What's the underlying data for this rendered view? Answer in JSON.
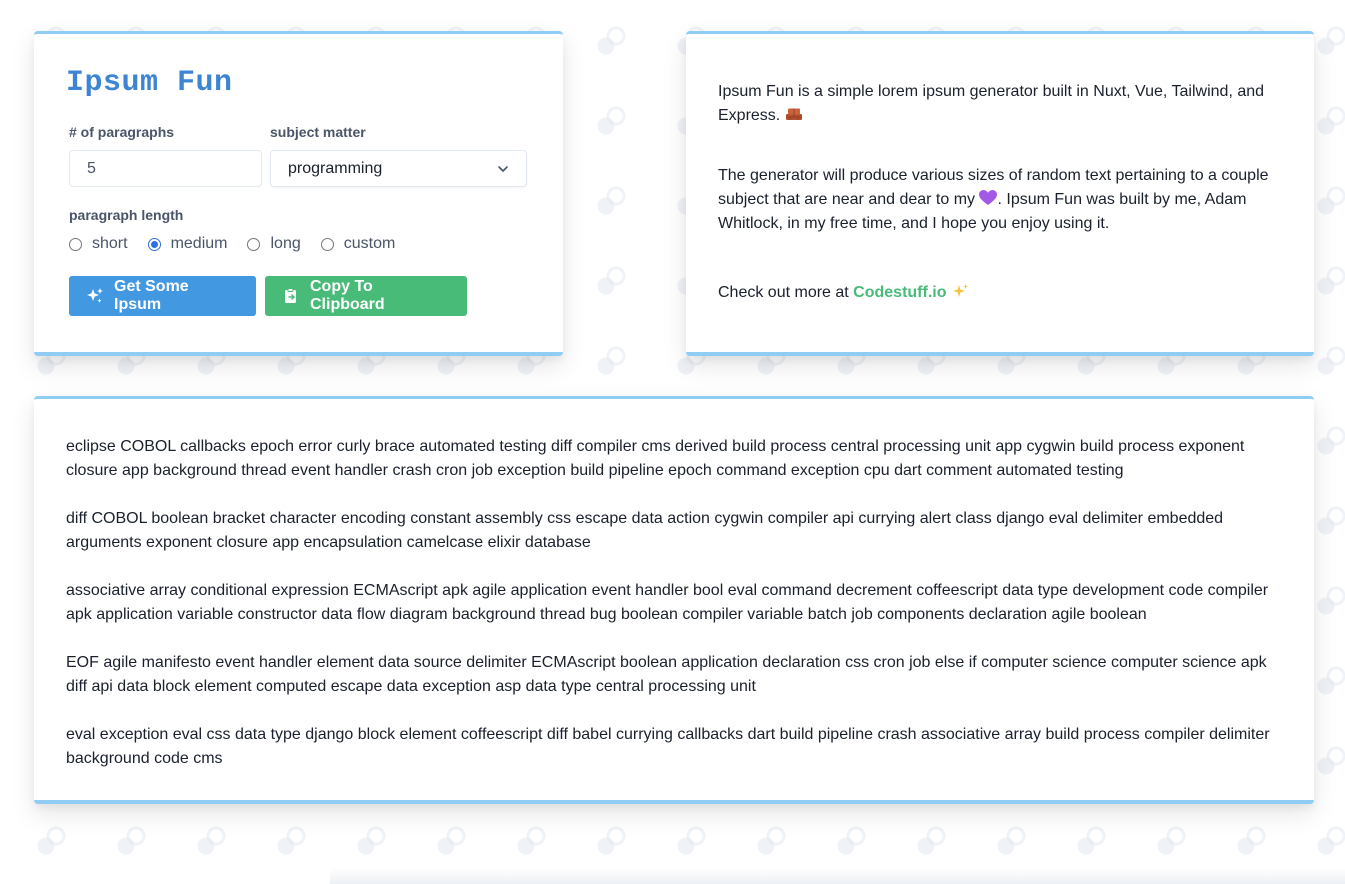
{
  "app": {
    "title": "Ipsum Fun"
  },
  "form": {
    "paragraphs_label": "# of paragraphs",
    "paragraphs_value": "5",
    "subject_label": "subject matter",
    "subject_value": "programming",
    "length_label": "paragraph length",
    "length_options": [
      {
        "label": "short",
        "checked": false
      },
      {
        "label": "medium",
        "checked": true
      },
      {
        "label": "long",
        "checked": false
      },
      {
        "label": "custom",
        "checked": false
      }
    ],
    "generate_button": "Get Some Ipsum",
    "copy_button": "Copy To Clipboard"
  },
  "about": {
    "p1": "Ipsum Fun is a simple lorem ipsum generator built in Nuxt, Vue, Tailwind, and Express.",
    "p2_before_heart": "The generator will produce various sizes of random text pertaining to a couple subject that are near and dear to my ",
    "p2_after_heart": ". Ipsum Fun was built by me, Adam Whitlock, in my free time, and I hope you enjoy using it.",
    "more_prefix": "Check out more at ",
    "more_link": "Codestuff.io"
  },
  "output": {
    "paragraphs": [
      "eclipse COBOL callbacks epoch error curly brace automated testing diff compiler cms derived build process central processing unit app cygwin build process exponent closure app background thread event handler crash cron job exception build pipeline epoch command exception cpu dart comment automated testing",
      "diff COBOL boolean bracket character encoding constant assembly css escape data action cygwin compiler api currying alert class django eval delimiter embedded arguments exponent closure app encapsulation camelcase elixir database",
      "associative array conditional expression ECMAscript apk agile application event handler bool eval command decrement coffeescript data type development code compiler apk application variable constructor data flow diagram background thread bug boolean compiler variable batch job components declaration agile boolean",
      "EOF agile manifesto event handler element data source delimiter ECMAscript boolean application declaration css cron job else if computer science computer science apk diff api data block element computed escape data exception asp data type central processing unit",
      "eval exception eval css data type django block element coffeescript diff babel currying callbacks dart build pipeline crash associative array build process compiler delimiter background code cms"
    ]
  },
  "colors": {
    "accent_blue": "#4299e1",
    "accent_green": "#48bb78",
    "title_blue": "#3d84d3",
    "card_border": "#90cdf4"
  },
  "icons": {
    "generate": "sparkles-icon",
    "copy": "clipboard-icon",
    "select": "chevron-down-icon"
  }
}
